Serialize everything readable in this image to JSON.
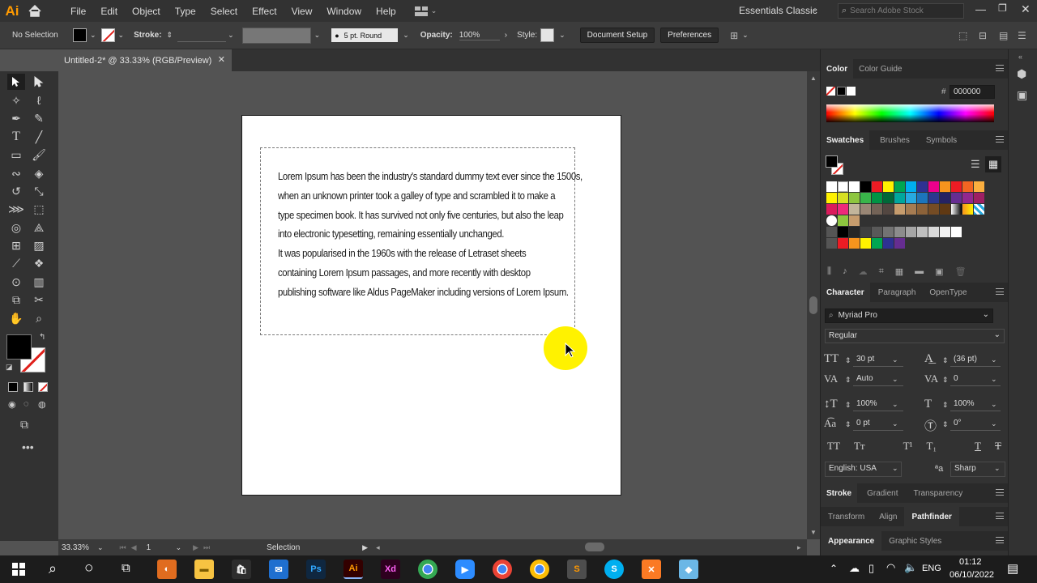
{
  "app": {
    "logo": "Ai"
  },
  "menu": [
    "File",
    "Edit",
    "Object",
    "Type",
    "Select",
    "Effect",
    "View",
    "Window",
    "Help"
  ],
  "workspace": {
    "name": "Essentials Classic",
    "search_placeholder": "Search Adobe Stock"
  },
  "control_bar": {
    "selection": "No Selection",
    "stroke_label": "Stroke:",
    "brush_size": "5 pt. Round",
    "opacity_label": "Opacity:",
    "opacity_value": "100%",
    "style_label": "Style:",
    "doc_setup": "Document Setup",
    "preferences": "Preferences"
  },
  "document": {
    "tab_title": "Untitled-2* @ 33.33% (RGB/Preview)",
    "text": [
      "Lorem Ipsum has been the industry's standard dummy text ever since the 1500s,",
      "when an unknown printer took a galley of type and scrambled it to make a",
      "type specimen book. It has survived not only five centuries, but also the leap",
      "into electronic typesetting, remaining essentially unchanged.",
      "It was popularised in the 1960s with the release of Letraset sheets",
      "containing Lorem Ipsum passages, and more recently with desktop",
      "publishing software like Aldus PageMaker including versions of Lorem Ipsum."
    ]
  },
  "status": {
    "zoom": "33.33%",
    "artboard": "1",
    "tool": "Selection"
  },
  "panels": {
    "color": {
      "tabs": [
        "Color",
        "Color Guide"
      ],
      "hex": "000000"
    },
    "swatches": {
      "tabs": [
        "Swatches",
        "Brushes",
        "Symbols"
      ]
    },
    "character": {
      "tabs": [
        "Character",
        "Paragraph",
        "OpenType"
      ],
      "font": "Myriad Pro",
      "style": "Regular",
      "size": "30 pt",
      "leading": "(36 pt)",
      "kerning": "Auto",
      "tracking": "0",
      "vscale": "100%",
      "hscale": "100%",
      "baseline": "0 pt",
      "rotation": "0°",
      "language": "English: USA",
      "antialias": "Sharp"
    },
    "stroke_group": [
      "Stroke",
      "Gradient",
      "Transparency"
    ],
    "transform_group": [
      "Transform",
      "Align",
      "Pathfinder"
    ],
    "appearance_group": [
      "Appearance",
      "Graphic Styles"
    ]
  },
  "taskbar": {
    "language": "ENG",
    "time": "01:12",
    "date": "06/10/2022"
  },
  "colors": {
    "accent": "#ff9a00",
    "cursor_highlight": "#fff200"
  }
}
